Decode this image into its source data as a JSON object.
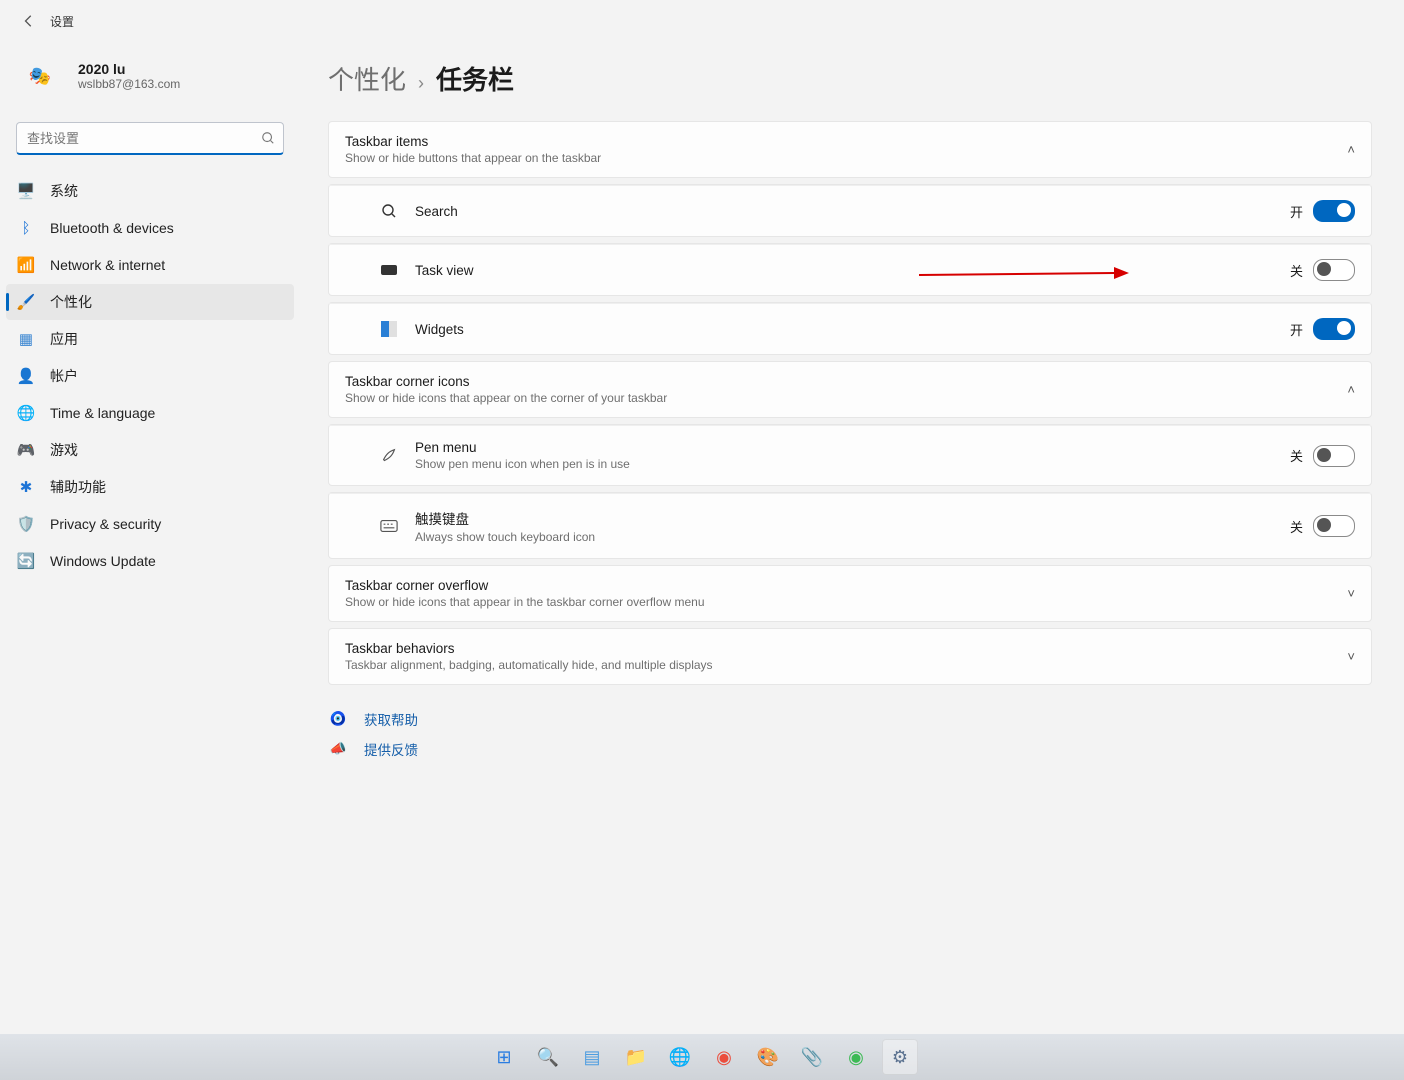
{
  "titlebar": {
    "title": "设置"
  },
  "account": {
    "name": "2020 lu",
    "email": "wslbb87@163.com"
  },
  "search": {
    "placeholder": "查找设置"
  },
  "nav": [
    {
      "id": "system",
      "label": "系统",
      "icon": "🖥️",
      "color": "#2a70c9"
    },
    {
      "id": "bluetooth",
      "label": "Bluetooth & devices",
      "icon": "ᛒ",
      "color": "#1d74d6"
    },
    {
      "id": "network",
      "label": "Network & internet",
      "icon": "📶",
      "color": "#1fa0e4"
    },
    {
      "id": "personalization",
      "label": "个性化",
      "icon": "🖌️",
      "color": "#d78b1f",
      "active": true
    },
    {
      "id": "apps",
      "label": "应用",
      "icon": "▦",
      "color": "#3a86d1"
    },
    {
      "id": "accounts",
      "label": "帐户",
      "icon": "👤",
      "color": "#3bab58"
    },
    {
      "id": "time",
      "label": "Time & language",
      "icon": "🌐",
      "color": "#3b8bc9"
    },
    {
      "id": "gaming",
      "label": "游戏",
      "icon": "🎮",
      "color": "#7d7d7d"
    },
    {
      "id": "accessibility",
      "label": "辅助功能",
      "icon": "✱",
      "color": "#1d74d6"
    },
    {
      "id": "privacy",
      "label": "Privacy & security",
      "icon": "🛡️",
      "color": "#8a8a8a"
    },
    {
      "id": "update",
      "label": "Windows Update",
      "icon": "🔄",
      "color": "#1fa0e4"
    }
  ],
  "breadcrumb": {
    "parent": "个性化",
    "sep": "›",
    "current": "任务栏"
  },
  "sections": {
    "taskbar_items": {
      "title": "Taskbar items",
      "subtitle": "Show or hide buttons that appear on the taskbar",
      "expanded": true,
      "rows": [
        {
          "id": "search",
          "label": "Search",
          "state": "开",
          "on": true
        },
        {
          "id": "taskview",
          "label": "Task view",
          "state": "关",
          "on": false,
          "annotated": true
        },
        {
          "id": "widgets",
          "label": "Widgets",
          "state": "开",
          "on": true
        }
      ]
    },
    "corner_icons": {
      "title": "Taskbar corner icons",
      "subtitle": "Show or hide icons that appear on the corner of your taskbar",
      "expanded": true,
      "rows": [
        {
          "id": "pen",
          "label": "Pen menu",
          "sub": "Show pen menu icon when pen is in use",
          "state": "关",
          "on": false
        },
        {
          "id": "touchkb",
          "label": "触摸键盘",
          "sub": "Always show touch keyboard icon",
          "state": "关",
          "on": false
        }
      ]
    },
    "overflow": {
      "title": "Taskbar corner overflow",
      "subtitle": "Show or hide icons that appear in the taskbar corner overflow menu",
      "expanded": false
    },
    "behaviors": {
      "title": "Taskbar behaviors",
      "subtitle": "Taskbar alignment, badging, automatically hide, and multiple displays",
      "expanded": false
    }
  },
  "links": {
    "help": "获取帮助",
    "feedback": "提供反馈"
  },
  "taskbar_apps": [
    {
      "id": "start",
      "icon": "⊞",
      "color": "#2b7de1"
    },
    {
      "id": "search",
      "icon": "🔍",
      "color": "#333"
    },
    {
      "id": "taskview",
      "icon": "▤",
      "color": "#4d9de0"
    },
    {
      "id": "explorer",
      "icon": "📁",
      "color": "#f3b13b"
    },
    {
      "id": "edge",
      "icon": "🌐",
      "color": "#29a3c7"
    },
    {
      "id": "chrome1",
      "icon": "◉",
      "color": "#eb4d3d"
    },
    {
      "id": "paint",
      "icon": "🎨",
      "color": "#c85aa5"
    },
    {
      "id": "office",
      "icon": "📎",
      "color": "#c94141"
    },
    {
      "id": "chrome2",
      "icon": "◉",
      "color": "#3cba54"
    },
    {
      "id": "settings",
      "icon": "⚙",
      "color": "#5b7290",
      "active": true
    }
  ]
}
